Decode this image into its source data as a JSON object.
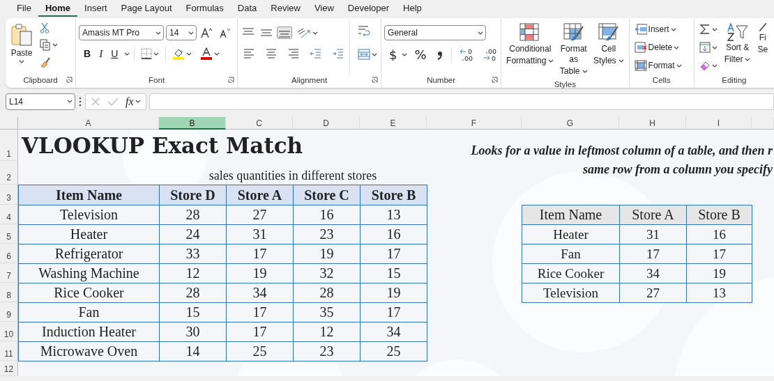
{
  "menu_tabs": [
    {
      "label": "File",
      "selected": false
    },
    {
      "label": "Home",
      "selected": true
    },
    {
      "label": "Insert",
      "selected": false
    },
    {
      "label": "Page Layout",
      "selected": false
    },
    {
      "label": "Formulas",
      "selected": false
    },
    {
      "label": "Data",
      "selected": false
    },
    {
      "label": "Review",
      "selected": false
    },
    {
      "label": "View",
      "selected": false
    },
    {
      "label": "Developer",
      "selected": false
    },
    {
      "label": "Help",
      "selected": false
    }
  ],
  "ribbon": {
    "groups": [
      {
        "kind": "clipboard",
        "label": "Clipboard",
        "paste": "Paste"
      },
      {
        "kind": "font",
        "label": "Font",
        "font_name": "Amasis MT Pro",
        "font_size": "14",
        "bold": "B",
        "italic": "I",
        "underline": "U"
      },
      {
        "kind": "alignment",
        "label": "Alignment",
        "vertical_align": [
          {
            "selected": false
          },
          {
            "selected": false
          },
          {
            "selected": true
          }
        ]
      },
      {
        "kind": "number",
        "label": "Number",
        "format": "General",
        "currency": "$",
        "percent": "%"
      },
      {
        "kind": "styles",
        "label": "Styles",
        "buttons": [
          {
            "lines": [
              "Conditional",
              "Formatting"
            ]
          },
          {
            "lines": [
              "Format as",
              "Table"
            ]
          },
          {
            "lines": [
              "Cell",
              "Styles"
            ]
          }
        ]
      },
      {
        "kind": "cells",
        "label": "Cells",
        "buttons": [
          "Insert",
          "Delete",
          "Format"
        ]
      },
      {
        "kind": "editing",
        "label": "Editing",
        "buttons": [
          {
            "lines": [
              "Sort &",
              "Filter"
            ]
          },
          {
            "lines": [
              "Fi",
              "Se"
            ]
          }
        ]
      }
    ]
  },
  "formula_bar": {
    "name_box": "L14",
    "fx": "fx"
  },
  "sheet": {
    "columns": [
      {
        "label": "A",
        "selected": false
      },
      {
        "label": "B",
        "selected": true
      },
      {
        "label": "C",
        "selected": false
      },
      {
        "label": "D",
        "selected": false
      },
      {
        "label": "E",
        "selected": false
      },
      {
        "label": "F",
        "selected": false
      },
      {
        "label": "G",
        "selected": false
      },
      {
        "label": "H",
        "selected": false
      },
      {
        "label": "I",
        "selected": false
      }
    ],
    "rows": [
      "1",
      "2",
      "3",
      "4",
      "5",
      "6",
      "7",
      "8",
      "9",
      "10",
      "11",
      "12"
    ],
    "title": "VLOOKUP Exact Match",
    "subtitle": "sales quantities in different stores",
    "description": [
      "Looks for a value in leftmost column of a table, and then r",
      "same row from a column you specify"
    ],
    "sales_table": {
      "columns": [
        "Item Name",
        "Store D",
        "Store A",
        "Store C",
        "Store B"
      ],
      "rows": [
        [
          "Television",
          "28",
          "27",
          "16",
          "13"
        ],
        [
          "Heater",
          "24",
          "31",
          "23",
          "16"
        ],
        [
          "Refrigerator",
          "33",
          "17",
          "19",
          "17"
        ],
        [
          "Washing Machine",
          "12",
          "19",
          "32",
          "15"
        ],
        [
          "Rice Cooker",
          "28",
          "34",
          "28",
          "19"
        ],
        [
          "Fan",
          "15",
          "17",
          "35",
          "17"
        ],
        [
          "Induction Heater",
          "30",
          "17",
          "12",
          "34"
        ],
        [
          "Microwave Oven",
          "14",
          "25",
          "23",
          "25"
        ]
      ]
    },
    "lookup_table": {
      "columns": [
        "Item Name",
        "Store A",
        "Store B"
      ],
      "rows": [
        [
          "Heater",
          "31",
          "16"
        ],
        [
          "Fan",
          "17",
          "17"
        ],
        [
          "Rice Cooker",
          "34",
          "19"
        ],
        [
          "Television",
          "27",
          "13"
        ]
      ]
    }
  }
}
